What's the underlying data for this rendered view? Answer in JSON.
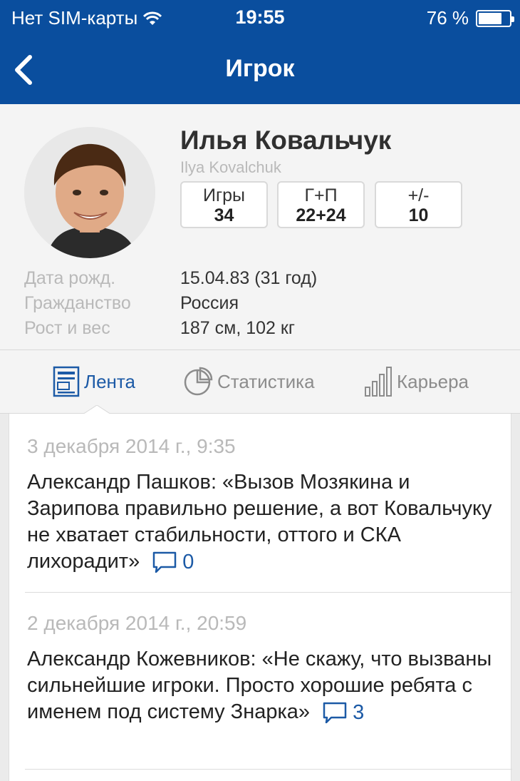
{
  "status_bar": {
    "carrier": "Нет SIM-карты",
    "time": "19:55",
    "battery": "76 %",
    "battery_level": 0.76
  },
  "nav": {
    "title": "Игрок"
  },
  "player": {
    "name": "Илья Ковальчук",
    "name_latin": "Ilya Kovalchuk",
    "stats": [
      {
        "label": "Игры",
        "value": "34"
      },
      {
        "label": "Г+П",
        "value": "22+24"
      },
      {
        "label": "+/-",
        "value": "10"
      }
    ],
    "info": [
      {
        "label": "Дата рожд.",
        "value": "15.04.83 (31 год)"
      },
      {
        "label": "Гражданство",
        "value": "Россия"
      },
      {
        "label": "Рост и вес",
        "value": "187 см, 102 кг"
      }
    ]
  },
  "tabs": [
    {
      "label": "Лента",
      "icon": "feed-icon",
      "active": true
    },
    {
      "label": "Статистика",
      "icon": "pie-chart-icon",
      "active": false
    },
    {
      "label": "Карьера",
      "icon": "bar-chart-icon",
      "active": false
    }
  ],
  "feed": [
    {
      "date": "3 декабря 2014 г., 9:35",
      "text": "Александр Пашков: «Вызов Мозякина и Зарипова правильно решение, а вот Ковальчуку не хватает стабильности, оттого и СКА лихорадит»",
      "comments": "0"
    },
    {
      "date": "2 декабря 2014 г., 20:59",
      "text": "Александр Кожевников: «Не скажу, что вызваны сильнейшие игроки. Просто хорошие ребята с именем под систему Знарка»",
      "comments": "3"
    }
  ],
  "colors": {
    "nav_bg": "#0a4e9e",
    "accent": "#1c5aa6"
  }
}
